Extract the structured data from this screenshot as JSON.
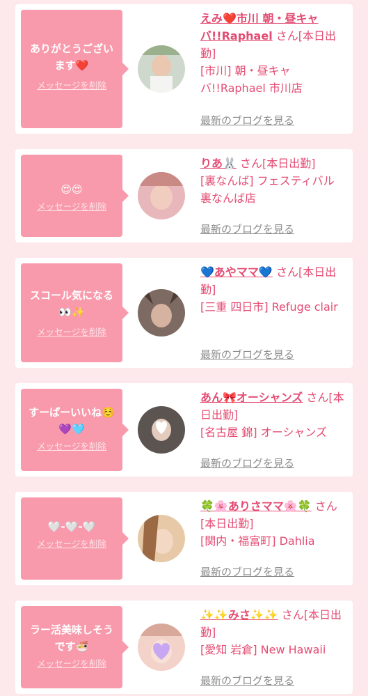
{
  "messages": [
    {
      "bubble_text": "ありがとうございます❤️",
      "delete_label": "メッセージを削除",
      "name": "えみ❤️市川 朝・昼キャバ!!Raphael",
      "suffix": "さん[本日出勤]",
      "shop": "[市川] 朝・昼キャバ!!Raphael 市川店",
      "blog_label": "最新のブログを見る"
    },
    {
      "bubble_text": "😍😍",
      "delete_label": "メッセージを削除",
      "name": "りあ🐰",
      "suffix": "さん[本日出勤]",
      "shop": "[裏なんば] フェスティバル 裏なんば店",
      "blog_label": "最新のブログを見る"
    },
    {
      "bubble_text": "スコール気になる👀✨",
      "delete_label": "メッセージを削除",
      "name": "💙あやママ💙",
      "suffix": "さん[本日出勤]",
      "shop": "[三重 四日市] Refuge clair",
      "blog_label": "最新のブログを見る"
    },
    {
      "bubble_text": "すーぱーいいね☺️💜🩵",
      "delete_label": "メッセージを削除",
      "name": "あん🎀オーシャンズ",
      "suffix": "さん[本日出勤]",
      "shop": "[名古屋 錦] オーシャンズ",
      "blog_label": "最新のブログを見る"
    },
    {
      "bubble_text": "🤍-🤍-🤍",
      "delete_label": "メッセージを削除",
      "name": "🍀🌸ありさママ🌸🍀",
      "suffix": "さん[本日出勤]",
      "shop": "[関内・福富町] Dahlia",
      "blog_label": "最新のブログを見る"
    },
    {
      "bubble_text": "ラー活美味しそうです🍜",
      "delete_label": "メッセージを削除",
      "name": "✨✨みさ✨✨",
      "suffix": "さん[本日出勤]",
      "shop": "[愛知 岩倉] New Hawaii",
      "blog_label": "最新のブログを見る"
    }
  ],
  "colors": {
    "background": "#fde8ec",
    "bubble": "#f89aac",
    "accent": "#e44b72",
    "link_gray": "#8c8c8c"
  }
}
